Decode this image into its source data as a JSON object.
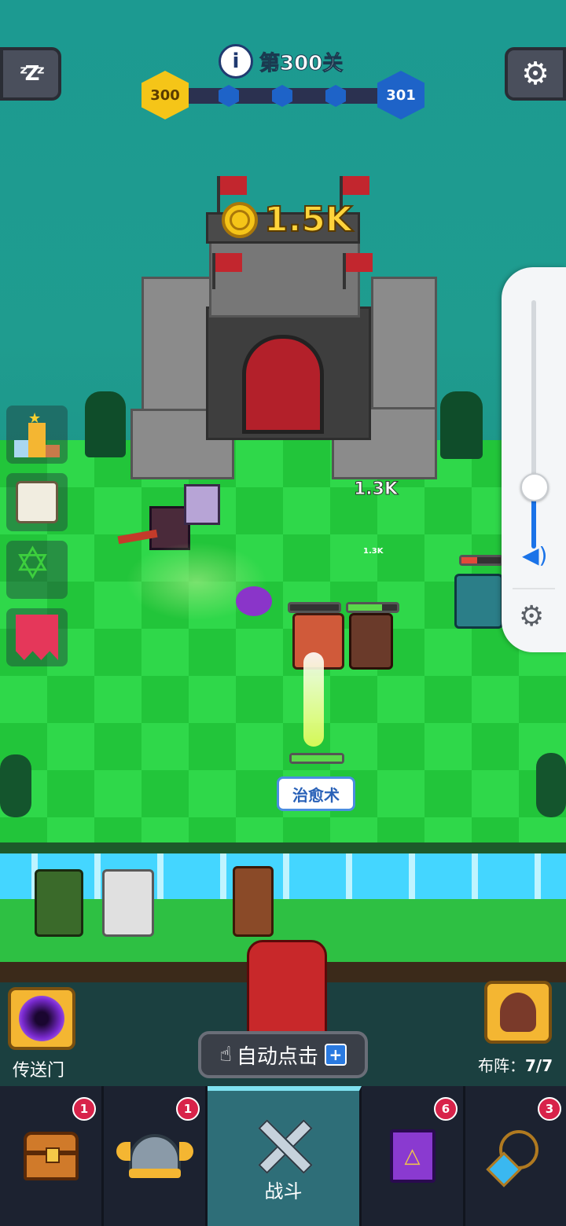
{
  "hud": {
    "level_label": "第300关",
    "current_level": "300",
    "next_level": "301",
    "castle_reward": "1.5K",
    "damage_big": "1.3K",
    "damage_small": "1.3K"
  },
  "skill": {
    "label": "治愈术"
  },
  "bottom": {
    "portal_label": "传送门",
    "auto_tap_label": "自动点击",
    "formation_label": "布阵：",
    "formation_value": "7/7"
  },
  "nav": {
    "items": [
      {
        "name": "chest",
        "badge": "1",
        "label": ""
      },
      {
        "name": "helmet",
        "badge": "1",
        "label": ""
      },
      {
        "name": "battle",
        "badge": "",
        "label": "战斗"
      },
      {
        "name": "spellbook",
        "badge": "6",
        "label": ""
      },
      {
        "name": "amulet",
        "badge": "3",
        "label": ""
      }
    ]
  },
  "colors": {
    "board_light": "#2fd84a",
    "board_dark": "#22c53a",
    "flag_red": "#c2262e",
    "badge_red": "#d8234a",
    "level_gold": "#f5c518",
    "level_blue": "#1e63c8",
    "nav_bg": "#1c2230",
    "nav_active": "#2e6e78"
  },
  "icons": [
    "sleep-zzz-icon",
    "info-icon",
    "gear-icon",
    "coin-icon",
    "volume-icon",
    "settings-gear-icon",
    "trophy-icon",
    "scroll-icon",
    "hexagram-icon",
    "red-banner-icon",
    "portal-icon",
    "tap-hand-icon",
    "plus-icon",
    "chest-icon",
    "helmet-icon",
    "crossed-swords-icon",
    "spellbook-icon",
    "amulet-icon"
  ]
}
